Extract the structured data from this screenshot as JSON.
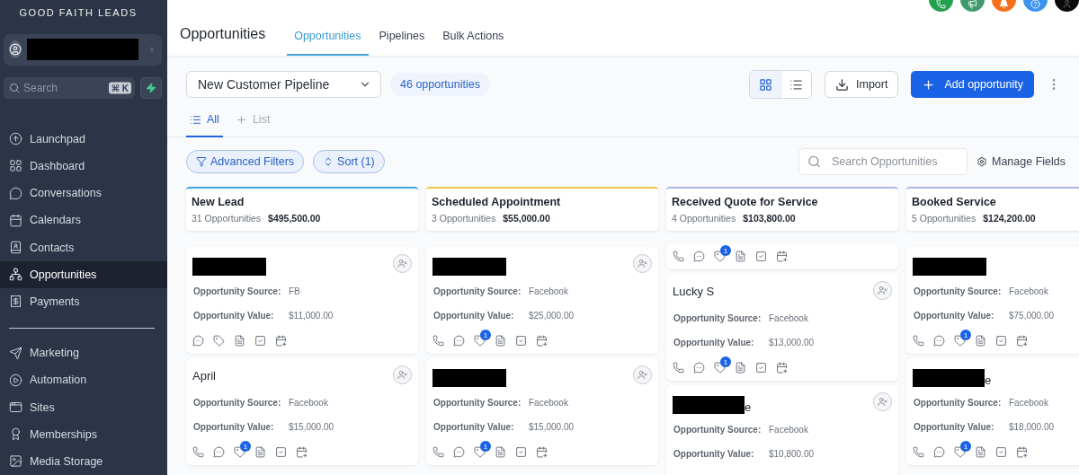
{
  "sidebar": {
    "logo": "GOOD FAITH LEADS",
    "account": {
      "redacted": true
    },
    "search": {
      "placeholder": "Search",
      "shortcut": "⌘ K"
    },
    "groups": [
      [
        {
          "label": "Launchpad",
          "selected": false
        },
        {
          "label": "Dashboard",
          "selected": false
        },
        {
          "label": "Conversations",
          "selected": false
        },
        {
          "label": "Calendars",
          "selected": false
        },
        {
          "label": "Contacts",
          "selected": false
        },
        {
          "label": "Opportunities",
          "selected": true
        },
        {
          "label": "Payments",
          "selected": false
        }
      ],
      [
        {
          "label": "Marketing",
          "selected": false
        },
        {
          "label": "Automation",
          "selected": false
        },
        {
          "label": "Sites",
          "selected": false
        },
        {
          "label": "Memberships",
          "selected": false
        },
        {
          "label": "Media Storage",
          "selected": false
        }
      ]
    ]
  },
  "header": {
    "title": "Opportunities",
    "tabs": [
      {
        "label": "Opportunities",
        "selected": true
      },
      {
        "label": "Pipelines",
        "selected": false
      },
      {
        "label": "Bulk Actions",
        "selected": false
      }
    ]
  },
  "toolbar": {
    "pipeline": "New Customer Pipeline",
    "count": "46 opportunities",
    "views": [
      {
        "kind": "grid",
        "selected": true
      },
      {
        "kind": "list",
        "selected": false
      }
    ],
    "import": "Import",
    "add": "Add opportunity"
  },
  "subtabs": [
    {
      "kind": "list",
      "label": "All",
      "selected": true
    },
    {
      "kind": "add",
      "label": "List",
      "selected": false
    }
  ],
  "filters": {
    "advanced": "Advanced Filters",
    "sort": "Sort (1)",
    "search_placeholder": "Search Opportunities",
    "manage": "Manage Fields"
  },
  "columns": [
    {
      "title": "New Lead",
      "count": "31 Opportunities",
      "total": "$495,500.00",
      "color": "#3aa3e3",
      "cards": [
        {
          "kind": "full",
          "redacted": true,
          "assign_button": true,
          "source_label": "Opportunity Source:",
          "source": "FB",
          "value_label": "Opportunity Value:",
          "value": "$11,000.00",
          "actions": [
            {
              "kind": "message"
            },
            {
              "kind": "tag"
            },
            {
              "kind": "note"
            },
            {
              "kind": "task"
            },
            {
              "kind": "appointment"
            }
          ]
        },
        {
          "kind": "full",
          "name": "April",
          "redacted": false,
          "assign_button": true,
          "source_label": "Opportunity Source:",
          "source": "Facebook",
          "value_label": "Opportunity Value:",
          "value": "$15,000.00",
          "actions": [
            {
              "kind": "call"
            },
            {
              "kind": "message"
            },
            {
              "kind": "tag",
              "badge": "1"
            },
            {
              "kind": "note"
            },
            {
              "kind": "task"
            },
            {
              "kind": "appointment"
            }
          ]
        }
      ]
    },
    {
      "title": "Scheduled Appointment",
      "count": "3 Opportunities",
      "total": "$55,000.00",
      "color": "#f0c64a",
      "cards": [
        {
          "kind": "full",
          "redacted": true,
          "assign_button": true,
          "source_label": "Opportunity Source:",
          "source": "Facebook",
          "value_label": "Opportunity Value:",
          "value": "$25,000.00",
          "actions": [
            {
              "kind": "call"
            },
            {
              "kind": "message"
            },
            {
              "kind": "tag",
              "badge": "1"
            },
            {
              "kind": "note"
            },
            {
              "kind": "task"
            },
            {
              "kind": "appointment"
            }
          ]
        },
        {
          "kind": "full",
          "redacted": true,
          "assign_button": true,
          "source_label": "Opportunity Source:",
          "source": "Facebook",
          "value_label": "Opportunity Value:",
          "value": "$15,000.00",
          "actions": [
            {
              "kind": "call"
            },
            {
              "kind": "message"
            },
            {
              "kind": "tag",
              "badge": "1"
            },
            {
              "kind": "note"
            },
            {
              "kind": "task"
            },
            {
              "kind": "appointment"
            }
          ]
        }
      ]
    },
    {
      "title": "Received Quote for Service",
      "count": "4 Opportunities",
      "total": "$103,800.00",
      "color": "#a9b8e6",
      "cards": [
        {
          "kind": "partial",
          "actions": [
            {
              "kind": "call"
            },
            {
              "kind": "message"
            },
            {
              "kind": "tag",
              "badge": "1"
            },
            {
              "kind": "note"
            },
            {
              "kind": "task"
            },
            {
              "kind": "appointment"
            }
          ]
        },
        {
          "kind": "full",
          "name": "Lucky S",
          "redacted": false,
          "assign_button": true,
          "source_label": "Opportunity Source:",
          "source": "Facebook",
          "value_label": "Opportunity Value:",
          "value": "$13,000.00",
          "actions": [
            {
              "kind": "call"
            },
            {
              "kind": "message"
            },
            {
              "kind": "tag",
              "badge": "1"
            },
            {
              "kind": "note"
            },
            {
              "kind": "task"
            },
            {
              "kind": "appointment"
            }
          ]
        },
        {
          "kind": "full",
          "name": "e",
          "redacted": true,
          "assign_button": true,
          "source_label": "Opportunity Source:",
          "source": "Facebook",
          "value_label": "Opportunity Value:",
          "value": "$10,800.00"
        }
      ]
    },
    {
      "title": "Booked Service",
      "count": "5 Opportunities",
      "total": "$124,200.00",
      "color": "#a9b8e6",
      "cards": [
        {
          "kind": "full",
          "redacted": true,
          "assign_button": false,
          "source_label": "Opportunity Source:",
          "source": "Facebook",
          "value_label": "Opportunity Value:",
          "value": "$75,000.00",
          "actions": [
            {
              "kind": "call"
            },
            {
              "kind": "message"
            },
            {
              "kind": "tag",
              "badge": "1"
            },
            {
              "kind": "note"
            },
            {
              "kind": "task"
            },
            {
              "kind": "appointment"
            }
          ]
        },
        {
          "kind": "full",
          "name": "e",
          "redacted": true,
          "assign_button": false,
          "source_label": "Opportunity Source:",
          "source": "Facebook",
          "value_label": "Opportunity Value:",
          "value": "$18,000.00",
          "actions": [
            {
              "kind": "call"
            },
            {
              "kind": "message"
            },
            {
              "kind": "tag",
              "badge": "1"
            },
            {
              "kind": "note"
            },
            {
              "kind": "task"
            },
            {
              "kind": "appointment"
            }
          ]
        }
      ]
    }
  ]
}
